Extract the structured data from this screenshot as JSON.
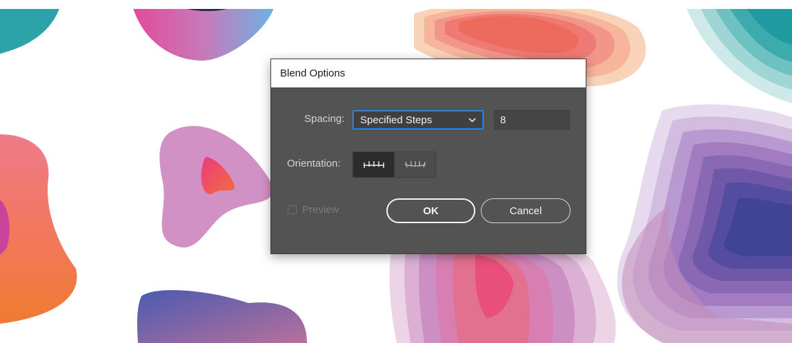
{
  "dialog": {
    "title": "Blend Options",
    "spacing": {
      "label": "Spacing:",
      "selected": "Specified Steps",
      "steps_value": "8"
    },
    "orientation": {
      "label": "Orientation:",
      "selected": "align-to-page"
    },
    "preview": {
      "label": "Preview",
      "checked": false
    },
    "ok_label": "OK",
    "cancel_label": "Cancel"
  },
  "colors": {
    "dialog_bg": "#535353",
    "accent": "#1473e6"
  }
}
